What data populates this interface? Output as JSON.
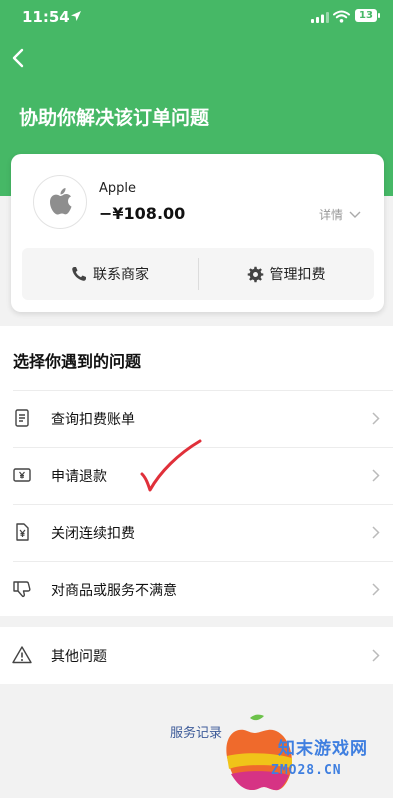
{
  "status_bar": {
    "time": "11:54",
    "battery": "13"
  },
  "header": {
    "title": "协助你解决该订单问题"
  },
  "order": {
    "merchant": "Apple",
    "amount": "−¥108.00",
    "detail_label": "详情",
    "contact_label": "联系商家",
    "manage_label": "管理扣费"
  },
  "issues": {
    "title": "选择你遇到的问题",
    "items": [
      {
        "label": "查询扣费账单",
        "icon": "receipt-icon"
      },
      {
        "label": "申请退款",
        "icon": "refund-icon"
      },
      {
        "label": "关闭连续扣费",
        "icon": "close-deduction-icon"
      },
      {
        "label": "对商品或服务不满意",
        "icon": "thumbs-down-icon"
      }
    ],
    "other": {
      "label": "其他问题",
      "icon": "warning-icon"
    }
  },
  "footer": {
    "service_record": "服务记录"
  },
  "watermark": {
    "cn": "知末游戏网",
    "en": "ZMO28.CN"
  },
  "colors": {
    "header_green": "#46b866",
    "link_blue": "#3d5b99",
    "annotation_red": "#e0303a"
  }
}
